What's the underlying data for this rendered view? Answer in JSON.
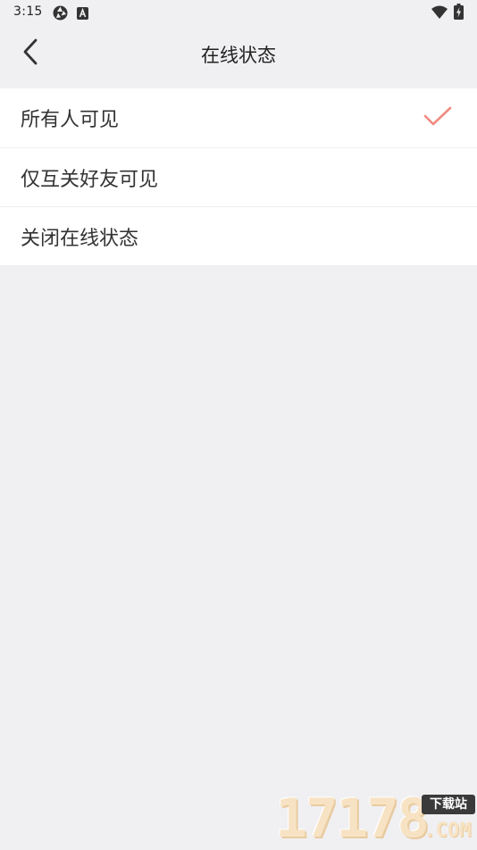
{
  "status_bar": {
    "time": "3:15",
    "left_icons": [
      "aperture-icon",
      "a-box-icon"
    ],
    "right_icons": [
      "wifi-icon",
      "battery-charging-icon"
    ]
  },
  "header": {
    "title": "在线状态",
    "back_icon": "chevron-left-icon"
  },
  "options": [
    {
      "label": "所有人可见",
      "selected": true
    },
    {
      "label": "仅互关好友可见",
      "selected": false
    },
    {
      "label": "关闭在线状态",
      "selected": false
    }
  ],
  "colors": {
    "background": "#f0f0f2",
    "row_background": "#ffffff",
    "check_accent": "#f08a80",
    "text": "#333333"
  },
  "watermark": {
    "number": "17178",
    "badge": "下载站",
    "suffix": ".COM"
  }
}
